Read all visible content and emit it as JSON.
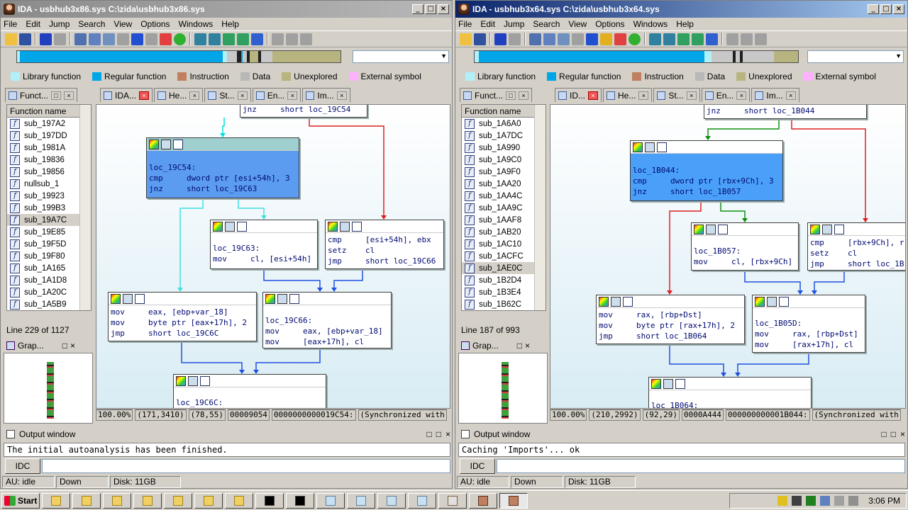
{
  "left": {
    "title": "IDA - usbhub3x86.sys C:\\zida\\usbhub3x86.sys",
    "menus": [
      "File",
      "Edit",
      "Jump",
      "Search",
      "View",
      "Options",
      "Windows",
      "Help"
    ],
    "legend": [
      "Library function",
      "Regular function",
      "Instruction",
      "Data",
      "Unexplored",
      "External symbol"
    ],
    "tabs": {
      "functions": "Funct...",
      "ida_view": "IDA...",
      "hex": "He...",
      "structs": "St...",
      "enums": "En...",
      "imports": "Im..."
    },
    "func_header": "Function name",
    "functions": [
      "sub_197A2",
      "sub_197DD",
      "sub_1981A",
      "sub_19836",
      "sub_19856",
      "nullsub_1",
      "sub_19923",
      "sub_199B3",
      "sub_19A7C",
      "sub_19E85",
      "sub_19F5D",
      "sub_19F80",
      "sub_1A165",
      "sub_1A1D8",
      "sub_1A20C",
      "sub_1A5B9"
    ],
    "selected_func": "sub_19A7C",
    "line_count": "Line 229 of 1127",
    "graph_label": "Grap...",
    "blocks": {
      "top": "jnz     short loc_19C54",
      "b1": "loc_19C54:\ncmp     dword ptr [esi+54h], 3\njnz     short loc_19C63",
      "b2": "loc_19C63:\nmov     cl, [esi+54h]",
      "b3": "cmp     [esi+54h], ebx\nsetz    cl\njmp     short loc_19C66",
      "b4": "mov     eax, [ebp+var_18]\nmov     byte ptr [eax+17h], 2\njmp     short loc_19C6C",
      "b5": "loc_19C66:\nmov     eax, [ebp+var_18]\nmov     [eax+17h], cl",
      "b6": "loc_19C6C:"
    },
    "status": [
      "100.00%",
      "(171,3410)",
      "(78,55)",
      "00009054",
      "0000000000019C54:",
      "(Synchronized with"
    ],
    "output_title": "Output window",
    "output_text": "The initial autoanalysis has been finished.",
    "idc": "IDC",
    "au": "AU:  idle",
    "dir": "Down",
    "disk": "Disk: 11GB"
  },
  "right": {
    "title": "IDA - usbhub3x64.sys C:\\zida\\usbhub3x64.sys",
    "menus": [
      "File",
      "Edit",
      "Jump",
      "Search",
      "View",
      "Options",
      "Windows",
      "Help"
    ],
    "legend": [
      "Library function",
      "Regular function",
      "Instruction",
      "Data",
      "Unexplored",
      "External symbol"
    ],
    "tabs": {
      "functions": "Funct...",
      "ida_view": "ID...",
      "hex": "He...",
      "structs": "St...",
      "enums": "En...",
      "imports": "Im..."
    },
    "func_header": "Function name",
    "functions": [
      "sub_1A6A0",
      "sub_1A7DC",
      "sub_1A990",
      "sub_1A9C0",
      "sub_1A9F0",
      "sub_1AA20",
      "sub_1AA4C",
      "sub_1AA9C",
      "sub_1AAF8",
      "sub_1AB20",
      "sub_1AC10",
      "sub_1ACFC",
      "sub_1AE0C",
      "sub_1B2D4",
      "sub_1B3E4",
      "sub_1B62C"
    ],
    "selected_func": "sub_1AE0C",
    "line_count": "Line 187 of 993",
    "graph_label": "Grap...",
    "blocks": {
      "top": "jnz     short loc_1B044",
      "b1": "loc_1B044:\ncmp     dword ptr [rbx+9Ch], 3\njnz     short loc_1B057",
      "b2": "loc_1B057:\nmov     cl, [rbx+9Ch]",
      "b3": "cmp     [rbx+9Ch], r\nsetz    cl\njmp     short loc_1B",
      "b4": "mov     rax, [rbp+Dst]\nmov     byte ptr [rax+17h], 2\njmp     short loc_1B064",
      "b5": "loc_1B05D:\nmov     rax, [rbp+Dst]\nmov     [rax+17h], cl",
      "b6": "loc_1B064:"
    },
    "status": [
      "100.00%",
      "(210,2992)",
      "(92,29)",
      "0000A444",
      "000000000001B044:",
      "(Synchronized with"
    ],
    "output_title": "Output window",
    "output_text": "Caching 'Imports'... ok",
    "idc": "IDC",
    "au": "AU:  idle",
    "dir": "Down",
    "disk": "Disk: 11GB"
  },
  "taskbar": {
    "start": "Start",
    "clock": "3:06 PM"
  },
  "colors": {
    "library": "#b0f0f8",
    "regular": "#00a6e8",
    "instruction": "#c08060",
    "data": "#b8b8b8",
    "unexplored": "#b8b480",
    "external": "#ffb0ff"
  }
}
